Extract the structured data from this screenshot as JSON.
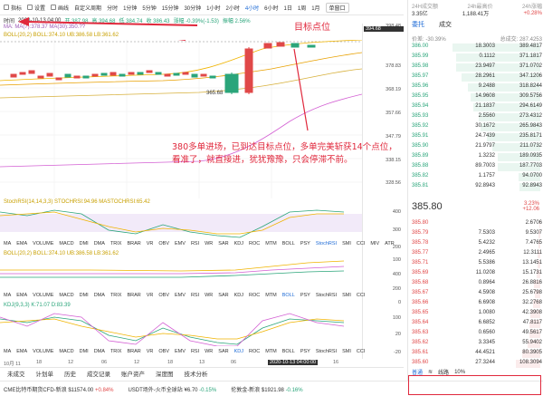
{
  "toolbar": {
    "items": [
      "指标",
      "设置",
      "画线",
      "自定义周期",
      "分时",
      "1分钟",
      "5分钟",
      "15分钟",
      "30分钟",
      "1小时",
      "2小时",
      "4小时",
      "6小时",
      "1日",
      "1周",
      "1月"
    ],
    "single_view": "单窗口"
  },
  "info": {
    "time_label": "时间",
    "time": "2020-10-13 04:00",
    "open": "开 387.98",
    "high": "高 394.68",
    "low": "低 384.74",
    "close": "收 386.43",
    "change": "涨幅 -0.39%(-1.53)",
    "amplitude": "振幅 2.56%"
  },
  "ma_line": "MA: MA(7):378.37 MA(30):350.??",
  "boll_line": "BOLL(20,2)  BOLL:374.10  UB:386.58  LB:361.62",
  "stoch_line": "StochRSI(14,14,3,3)  STOCHRSI:94.96  MASTOCHRSI:65.42",
  "boll2_line": "BOLL(20,2)  BOLL:374.10  UB:386.58  LB:361.62",
  "kdj_line": "KDJ(9,3,3)  K:71.07  D:83.39",
  "price_axis": [
    "398.48",
    "394.68",
    "378.83",
    "368.19",
    "357.66",
    "347.79",
    "338.15",
    "328.56",
    "400",
    "300",
    "200",
    "100",
    "400",
    "200",
    "0",
    "100",
    "20",
    "-20"
  ],
  "price_tag": "394.68",
  "low_label": "365.68",
  "indicator_tabs": [
    "MA",
    "EMA",
    "VOLUME",
    "MACD",
    "DMI",
    "DMA",
    "TRIX",
    "BRAR",
    "VR",
    "OBV",
    "EMV",
    "RSI",
    "WR",
    "SAR",
    "KDJ",
    "ROC",
    "MTM",
    "BOLL",
    "PSY",
    "StochRSI",
    "SMI",
    "CCI",
    "MIV",
    "ATR"
  ],
  "indicator_tabs2": [
    "MA",
    "EMA",
    "VOLUME",
    "MACD",
    "DMI",
    "DMA",
    "TRIX",
    "BRAR",
    "VR",
    "OBV",
    "EMV",
    "RSI",
    "WR",
    "SAR",
    "KDJ",
    "ROC",
    "MTM",
    "BOLL",
    "PSY",
    "StochRSI",
    "SMI",
    "CCI"
  ],
  "indicator_tabs3": [
    "MA",
    "EMA",
    "VOLUME",
    "MACD",
    "DMI",
    "DMA",
    "TRIX",
    "BRAR",
    "VR",
    "OBV",
    "EMV",
    "RSI",
    "WR",
    "SAR",
    "KDJ",
    "ROC",
    "MTM",
    "BOLL",
    "PSY",
    "StochRSI",
    "SMI",
    "CCI"
  ],
  "time_axis": [
    "10月 11",
    "18",
    "12",
    "06",
    "12",
    "18",
    "13",
    "06",
    "12",
    "16"
  ],
  "date_tag": "2020-10-13 04:00:00",
  "bottom_tabs": [
    "未成交",
    "计划单",
    "历史",
    "成交记录",
    "账户资产",
    "深度图",
    "技术分析"
  ],
  "tickers": [
    {
      "name": "CME比特币期货CFD-新浪",
      "price": "$11574.00",
      "change": "+0.84%"
    },
    {
      "name": "USDT场外-火币全球站",
      "price": "¥6.70",
      "change": "-0.15%"
    },
    {
      "name": "伦敦金-新浪",
      "price": "$1921.98",
      "change": "-0.16%"
    }
  ],
  "annotation_target": "目标点位",
  "annotation_text": "380多单进场，已到达目标点位，多单完美斩获14个点位，看准了，就直接进，犹犹豫豫，只会停滞不前。",
  "right": {
    "header1": "24H成交额",
    "header2": "24h最高价",
    "header3": "24h涨幅",
    "h_vals": [
      "3.35亿",
      "1,188.41万",
      "+0.28%"
    ],
    "tabs": [
      "委托",
      "成交"
    ],
    "stat1": "价差: -30.39%",
    "stat2": "总成交: 287.4253",
    "bids": [
      [
        "386.00",
        "18.3003",
        "389.4817"
      ],
      [
        "385.99",
        "0.1112",
        "371.1817"
      ],
      [
        "385.98",
        "23.9497",
        "371.0702"
      ],
      [
        "385.97",
        "28.2961",
        "347.1206"
      ],
      [
        "385.96",
        "9.2488",
        "318.8244"
      ],
      [
        "385.95",
        "14.9608",
        "309.5756"
      ],
      [
        "385.94",
        "21.1837",
        "294.6149"
      ],
      [
        "385.93",
        "2.5560",
        "273.4312"
      ],
      [
        "385.92",
        "30.1672",
        "265.9843"
      ],
      [
        "385.91",
        "24.7439",
        "235.8171"
      ],
      [
        "385.90",
        "21.9797",
        "211.0732"
      ],
      [
        "385.89",
        "1.3232",
        "189.0935"
      ],
      [
        "385.88",
        "89.7003",
        "187.7703"
      ],
      [
        "385.82",
        "1.1757",
        "94.0700"
      ],
      [
        "385.81",
        "92.8943",
        "92.8943"
      ]
    ],
    "mid": "385.80",
    "mid_change": "3.23%",
    "mid_change2": "+12.06",
    "asks": [
      [
        "385.80",
        "",
        "2.6706"
      ],
      [
        "385.79",
        "7.5303",
        "9.5307"
      ],
      [
        "385.78",
        "5.4232",
        "7.4765"
      ],
      [
        "385.77",
        "2.4965",
        "12.3111"
      ],
      [
        "385.71",
        "5.5386",
        "13.1451"
      ],
      [
        "385.69",
        "11.0208",
        "15.1731"
      ],
      [
        "385.68",
        "0.8964",
        "26.8816"
      ],
      [
        "385.67",
        "4.5908",
        "25.6798"
      ],
      [
        "385.66",
        "6.6908",
        "32.2768"
      ],
      [
        "385.65",
        "1.0080",
        "42.3908"
      ],
      [
        "385.64",
        "6.6852",
        "47.8117"
      ],
      [
        "385.63",
        "0.6560",
        "49.5617"
      ],
      [
        "385.62",
        "3.3345",
        "55.9402"
      ],
      [
        "385.61",
        "44.4521",
        "80.3905"
      ],
      [
        "385.60",
        "27.3244",
        "108.3094"
      ]
    ],
    "footer_tab": "普通",
    "network": "线路",
    "footer_val": "10%"
  }
}
